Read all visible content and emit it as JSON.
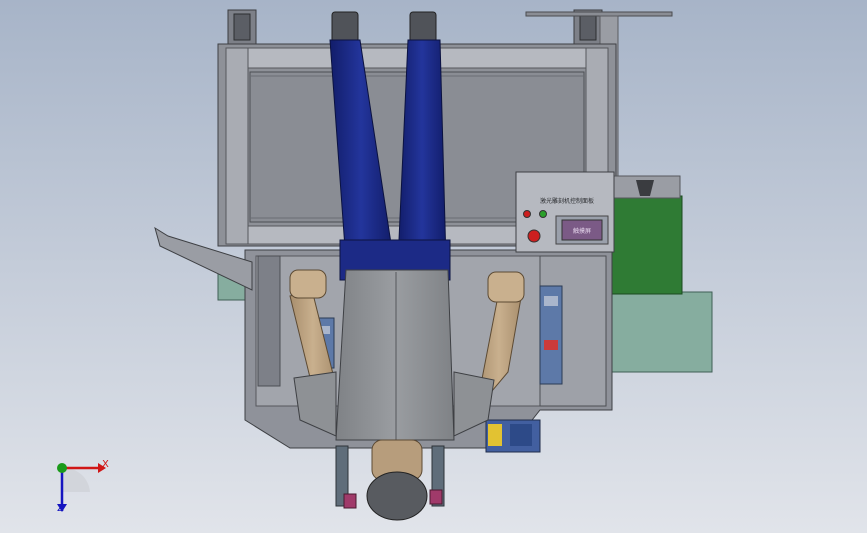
{
  "viewport": {
    "background_top": "#a9b5c8",
    "background_bottom": "#dfe3ea"
  },
  "colors": {
    "frame": "#8c8f96",
    "frame_dark": "#4b4d52",
    "frame_light": "#b8bbc2",
    "jeans": "#1c2a86",
    "jeans_dark": "#0f1753",
    "shirt": "#8e9195",
    "skin": "#b79d7c",
    "teal": "#7fa89b",
    "green": "#2f7a35",
    "panel": "#b3b6bd",
    "screen": "#7b5a86",
    "red": "#cc1f1f",
    "axis_x": "#d01616",
    "axis_y": "#1a9a1a",
    "axis_z": "#1515c0"
  },
  "control_panel": {
    "title": "激光雕刻机控制面板",
    "screen_text": "触摸屏"
  },
  "axes": {
    "x_label": "X",
    "z_label": "Z"
  }
}
